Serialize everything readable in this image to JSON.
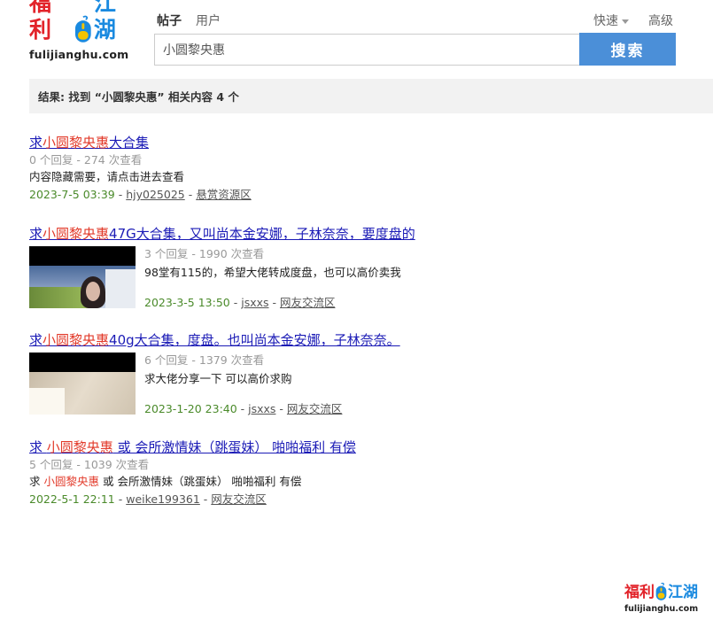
{
  "logo": {
    "cn_left": "福利",
    "cn_right": "江湖",
    "url": "fulijianghu.com"
  },
  "tabs": [
    {
      "label": "帖子"
    },
    {
      "label": "用户"
    }
  ],
  "quick_label": "快速",
  "advanced_label": "高级",
  "search": {
    "value": "小圆黎央惠",
    "button": "搜索"
  },
  "result_summary": "结果: 找到 “小圆黎央惠” 相关内容 4 个",
  "results": [
    {
      "title_pre": "求",
      "title_hl": "小圆黎央惠",
      "title_post": "大合集",
      "meta": "0 个回复 - 274 次查看",
      "desc_pre": "内容隐藏需要，请点击进去查看",
      "desc_hl": "",
      "desc_post": "",
      "date": "2023-7-5 03:39",
      "author": "hjy025025",
      "forum": "悬赏资源区"
    },
    {
      "title_pre": "求",
      "title_hl": "小圆黎央惠",
      "title_post": "47G大合集，又叫尚本金安娜，子林奈奈，要度盘的",
      "meta": "3 个回复 - 1990 次查看",
      "desc_pre": "98堂有115的，希望大佬转成度盘，也可以高价卖我",
      "desc_hl": "",
      "desc_post": "",
      "date": "2023-3-5 13:50",
      "author": "jsxxs",
      "forum": "网友交流区"
    },
    {
      "title_pre": "求",
      "title_hl": "小圆黎央惠",
      "title_post": "40g大合集，度盘。也叫尚本金安娜，子林奈奈。",
      "meta": "6 个回复 - 1379 次查看",
      "desc_pre": "求大佬分享一下 可以高价求购",
      "desc_hl": "",
      "desc_post": "",
      "date": "2023-1-20 23:40",
      "author": "jsxxs",
      "forum": "网友交流区"
    },
    {
      "title_pre": "求 ",
      "title_hl": "小圆黎央惠",
      "title_post": " 或 会所激情妹（跳蛋妹） 啪啪福利 有偿",
      "meta": "5 个回复 - 1039 次查看",
      "desc_pre": "求 ",
      "desc_hl": "小圆黎央惠",
      "desc_post": " 或 会所激情妹（跳蛋妹） 啪啪福利 有偿",
      "date": "2022-5-1 22:11",
      "author": "weike199361",
      "forum": "网友交流区"
    }
  ],
  "separator": " - ",
  "colors": {
    "accent": "#4b8fd8",
    "highlight": "#e23a2a",
    "link": "#1b1bb6",
    "date": "#4a8a2a"
  }
}
